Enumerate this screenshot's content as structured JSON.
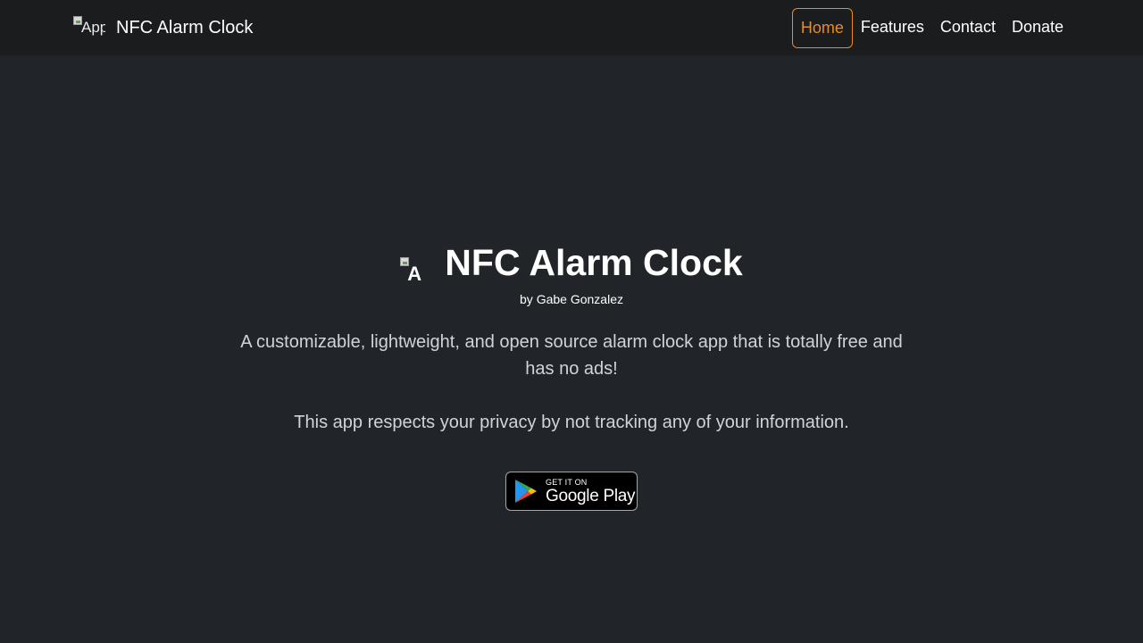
{
  "header": {
    "brand": {
      "logo_alt": "App",
      "name": "NFC Alarm Clock"
    },
    "nav": [
      {
        "label": "Home",
        "active": true
      },
      {
        "label": "Features",
        "active": false
      },
      {
        "label": "Contact",
        "active": false
      },
      {
        "label": "Donate",
        "active": false
      }
    ],
    "accent_color": "#f08a1d"
  },
  "hero": {
    "logo_alt": "A",
    "title": "NFC Alarm Clock",
    "byline": "by Gabe Gonzalez",
    "description": "A customizable, lightweight, and open source alarm clock app that is totally free and has no ads!",
    "privacy": "This app respects your privacy by not tracking any of your information.",
    "store_badge": {
      "small_text": "GET IT ON",
      "big_text": "Google Play",
      "icon": "google-play-icon"
    }
  },
  "colors": {
    "background": "#212529",
    "navbar": "#1b1c1d",
    "muted_text": "#ced4da"
  }
}
